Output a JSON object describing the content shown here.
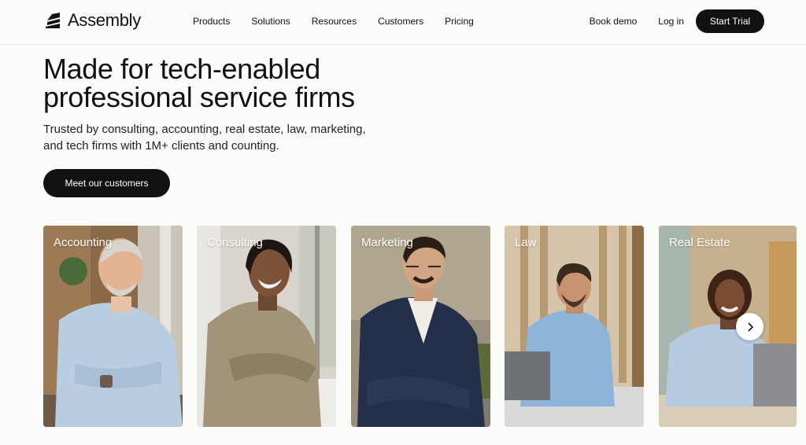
{
  "brand": {
    "name": "Assembly"
  },
  "nav": {
    "links": [
      "Products",
      "Solutions",
      "Resources",
      "Customers",
      "Pricing"
    ],
    "book_demo": "Book demo",
    "log_in": "Log in",
    "start_trial": "Start Trial"
  },
  "hero": {
    "title_line1": "Made for tech-enabled",
    "title_line2": "professional service firms",
    "subtitle_line1": "Trusted by consulting, accounting, real estate, law, marketing,",
    "subtitle_line2": "and tech firms with 1M+ clients and counting.",
    "cta": "Meet our customers"
  },
  "cards": [
    {
      "label": "Accounting"
    },
    {
      "label": "Consulting"
    },
    {
      "label": "Marketing"
    },
    {
      "label": "Law"
    },
    {
      "label": "Real Estate"
    }
  ],
  "carousel": {
    "next_icon": "chevron-right-icon"
  }
}
